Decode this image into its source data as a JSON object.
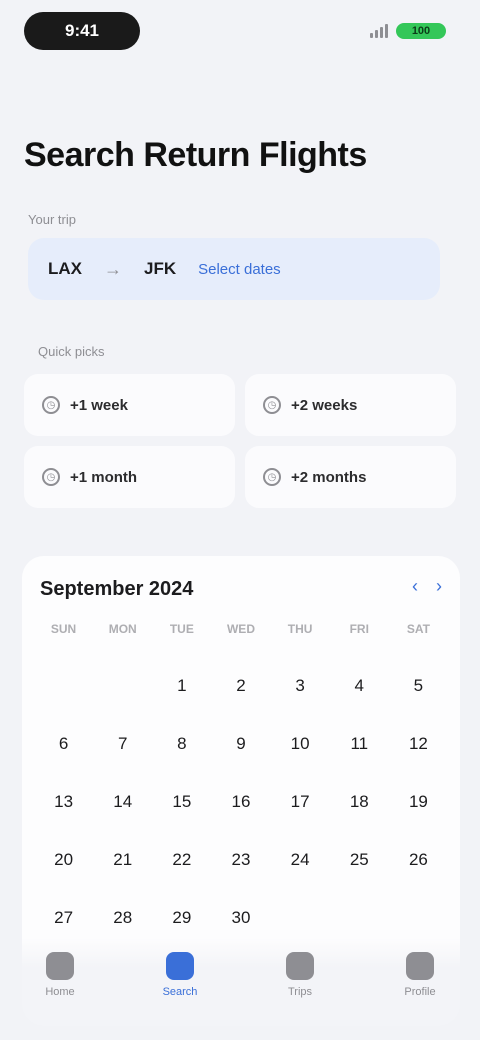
{
  "status_bar": {
    "time": "9:41",
    "battery": "100"
  },
  "header": {
    "title": "Search Return Flights"
  },
  "route": {
    "caption": "Your trip",
    "from": "LAX",
    "arrow": "→",
    "to": "JFK",
    "dates": "Select dates"
  },
  "quick": {
    "label": "Quick picks",
    "items": [
      {
        "label": "+1 week",
        "icon": "clock-icon"
      },
      {
        "label": "+2 weeks",
        "icon": "clock-icon"
      },
      {
        "label": "+1 month",
        "icon": "clock-icon"
      },
      {
        "label": "+2 months",
        "icon": "clock-icon"
      }
    ]
  },
  "calendar": {
    "month": "September 2024",
    "prev": "‹",
    "next": "›",
    "weekdays": [
      "SUN",
      "MON",
      "TUE",
      "WED",
      "THU",
      "FRI",
      "SAT"
    ],
    "days": [
      "",
      "",
      "1",
      "2",
      "3",
      "4",
      "5",
      "6",
      "7",
      "8",
      "9",
      "10",
      "11",
      "12",
      "13",
      "14",
      "15",
      "16",
      "17",
      "18",
      "19",
      "20",
      "21",
      "22",
      "23",
      "24",
      "25",
      "26",
      "27",
      "28",
      "29",
      "30"
    ]
  },
  "tabs": [
    {
      "label": "Home",
      "active": false
    },
    {
      "label": "Search",
      "active": true
    },
    {
      "label": "Trips",
      "active": false
    },
    {
      "label": "Profile",
      "active": false
    }
  ],
  "colors": {
    "accent": "#3a6fd8",
    "background": "#f2f3f7",
    "battery": "#34c759"
  }
}
